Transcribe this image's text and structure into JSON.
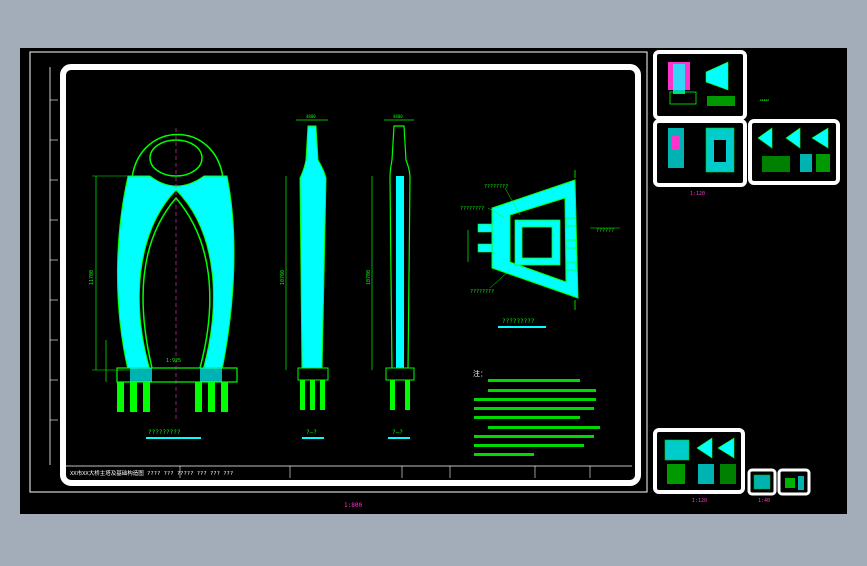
{
  "viewport": {
    "background": "#a3acb9",
    "model_space_color": "#000000",
    "cyan": "#00ffff",
    "green": "#00ff00",
    "magenta": "#ff33cc",
    "white": "#ffffff"
  },
  "labels": {
    "overall_scale": "1:800",
    "detail_scale_a": "1:120",
    "detail_scale_b": "1:120",
    "detail_scale_c": "1:40",
    "section_a": "?????????",
    "section_b": "?—?",
    "section_c": "?—?",
    "plan_view": "?????????",
    "dim_elev": "1:925",
    "dim_total": "11700",
    "dim_total_side": "10700",
    "dim_total_side2": "10700",
    "plan_callout_1": "????????",
    "plan_callout_2": "????????",
    "plan_callout_3": "??????",
    "plan_callout_4": "????????",
    "notes_heading": "注：",
    "title_block": "XX市XX大桥主塔及基础构造图  ????  ???  ?????  ???  ???  ???"
  }
}
